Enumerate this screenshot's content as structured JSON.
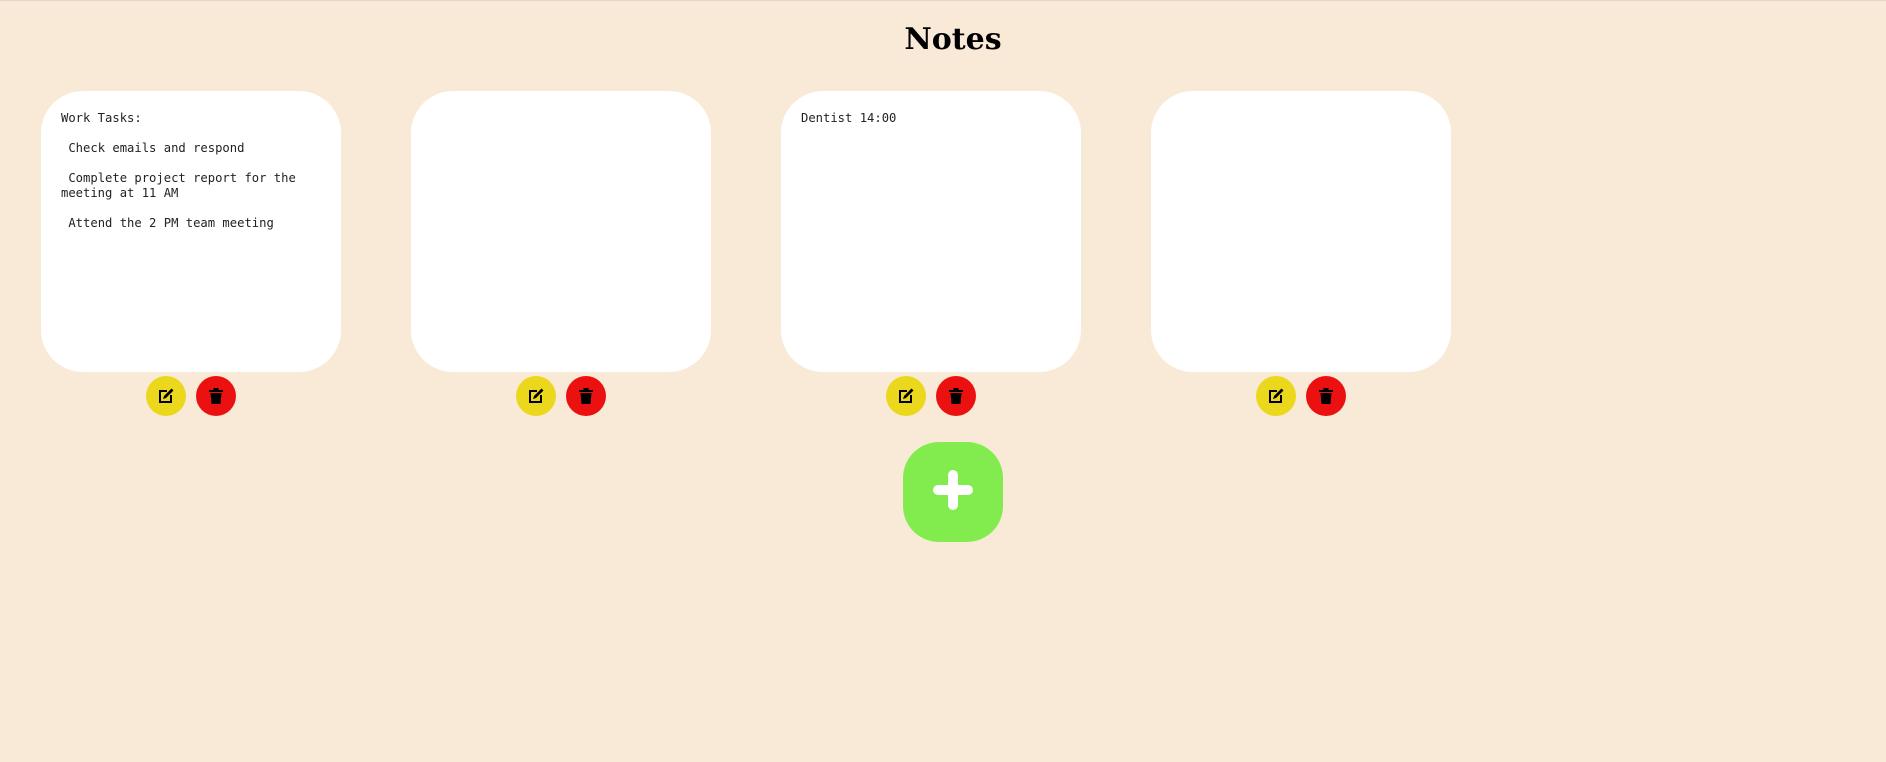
{
  "page": {
    "title": "Notes"
  },
  "notes": [
    {
      "text": "Work Tasks:\n\n Check emails and respond\n\n Complete project report for the meeting at 11 AM\n\n Attend the 2 PM team meeting",
      "edit_icon": "edit-icon",
      "delete_icon": "trash-icon"
    },
    {
      "text": "",
      "edit_icon": "edit-icon",
      "delete_icon": "trash-icon"
    },
    {
      "text": "Dentist 14:00",
      "edit_icon": "edit-icon",
      "delete_icon": "trash-icon"
    },
    {
      "text": "",
      "edit_icon": "edit-icon",
      "delete_icon": "trash-icon"
    }
  ],
  "add_button": {
    "icon": "plus-icon"
  },
  "colors": {
    "background": "#f9ead7",
    "note": "#ffffff",
    "edit": "#ebd71b",
    "delete": "#ec1111",
    "add": "#82ec4e"
  }
}
